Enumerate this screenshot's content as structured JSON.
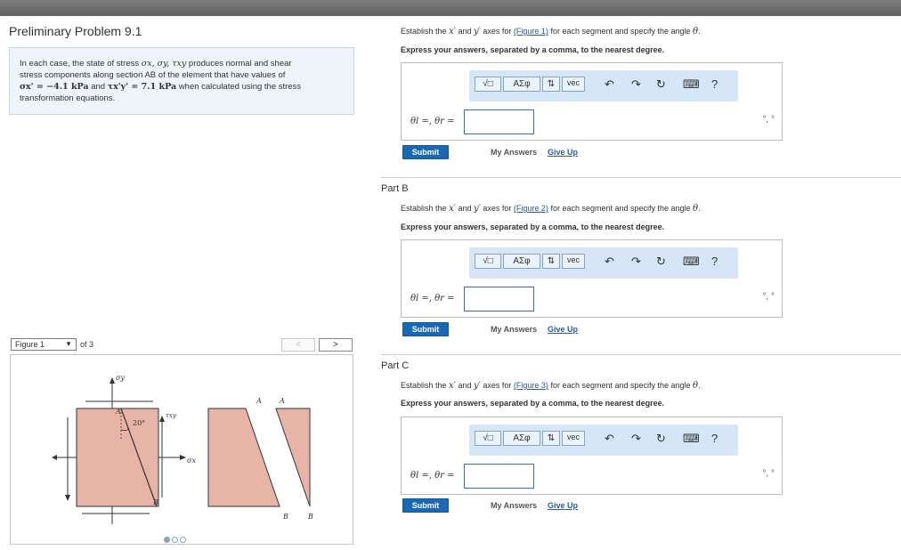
{
  "problem": {
    "title": "Preliminary Problem 9.1",
    "desc_1": "In each case, the state of stress ",
    "desc_sym": "σx, σy, τxy",
    "desc_2": " produces normal and shear",
    "desc_3": "stress components along section AB of the element that have values of",
    "desc_4a": "σx' = −4.1 kPa",
    "desc_4b": " and ",
    "desc_4c": "τx'y' = 7.1 kPa",
    "desc_4d": " when calculated using the stress",
    "desc_5": "transformation equations."
  },
  "figure": {
    "select_label": "Figure 1",
    "of_label": "of 3",
    "prev": "<",
    "next": ">",
    "labels": {
      "sy": "σy",
      "txy": "τxy",
      "sx": "σx",
      "angle": "20°",
      "A": "A",
      "B": "B"
    }
  },
  "parts": [
    {
      "label": "",
      "prompt_pre": "Establish the ",
      "x_sym": "x′",
      "prompt_mid": " and ",
      "y_sym": "y′",
      "prompt_for": " axes for ",
      "figure_link": "(Figure 1)",
      "prompt_post": " for each segment and specify the angle ",
      "theta": "θ",
      "period": ".",
      "instruction": "Express your answers, separated by a comma, to the nearest degree.",
      "answer_label": "θl =, θr =",
      "units": "°, °",
      "submit": "Submit",
      "my_answers": "My Answers",
      "give_up": "Give Up"
    },
    {
      "label": "Part B",
      "prompt_pre": "Establish the ",
      "x_sym": "x′",
      "prompt_mid": " and ",
      "y_sym": "y′",
      "prompt_for": " axes for ",
      "figure_link": "(Figure 2)",
      "prompt_post": " for each segment and specify the angle ",
      "theta": "θ",
      "period": ".",
      "instruction": "Express your answers, separated by a comma, to the nearest degree.",
      "answer_label": "θl =, θr =",
      "units": "°, °",
      "submit": "Submit",
      "my_answers": "My Answers",
      "give_up": "Give Up"
    },
    {
      "label": "Part C",
      "prompt_pre": "Establish the ",
      "x_sym": "x′",
      "prompt_mid": " and ",
      "y_sym": "y′",
      "prompt_for": " axes for ",
      "figure_link": "(Figure 3)",
      "prompt_post": " for each segment and specify the angle ",
      "theta": "θ",
      "period": ".",
      "instruction": "Express your answers, separated by a comma, to the nearest degree.",
      "answer_label": "θl =, θr =",
      "units": "°, °",
      "submit": "Submit",
      "my_answers": "My Answers",
      "give_up": "Give Up"
    }
  ],
  "toolbar": {
    "sqrt": "√□",
    "greek": "ΑΣφ",
    "arrows": "⇅",
    "vec": "vec",
    "undo": "↶",
    "redo": "↷",
    "reset": "↻",
    "keyboard": "⌨",
    "help": "?"
  },
  "colors": {
    "accent": "#1a67b3",
    "toolbar": "#d6e6f7",
    "panel": "#eef4fa",
    "element": "#e8b4a8"
  }
}
